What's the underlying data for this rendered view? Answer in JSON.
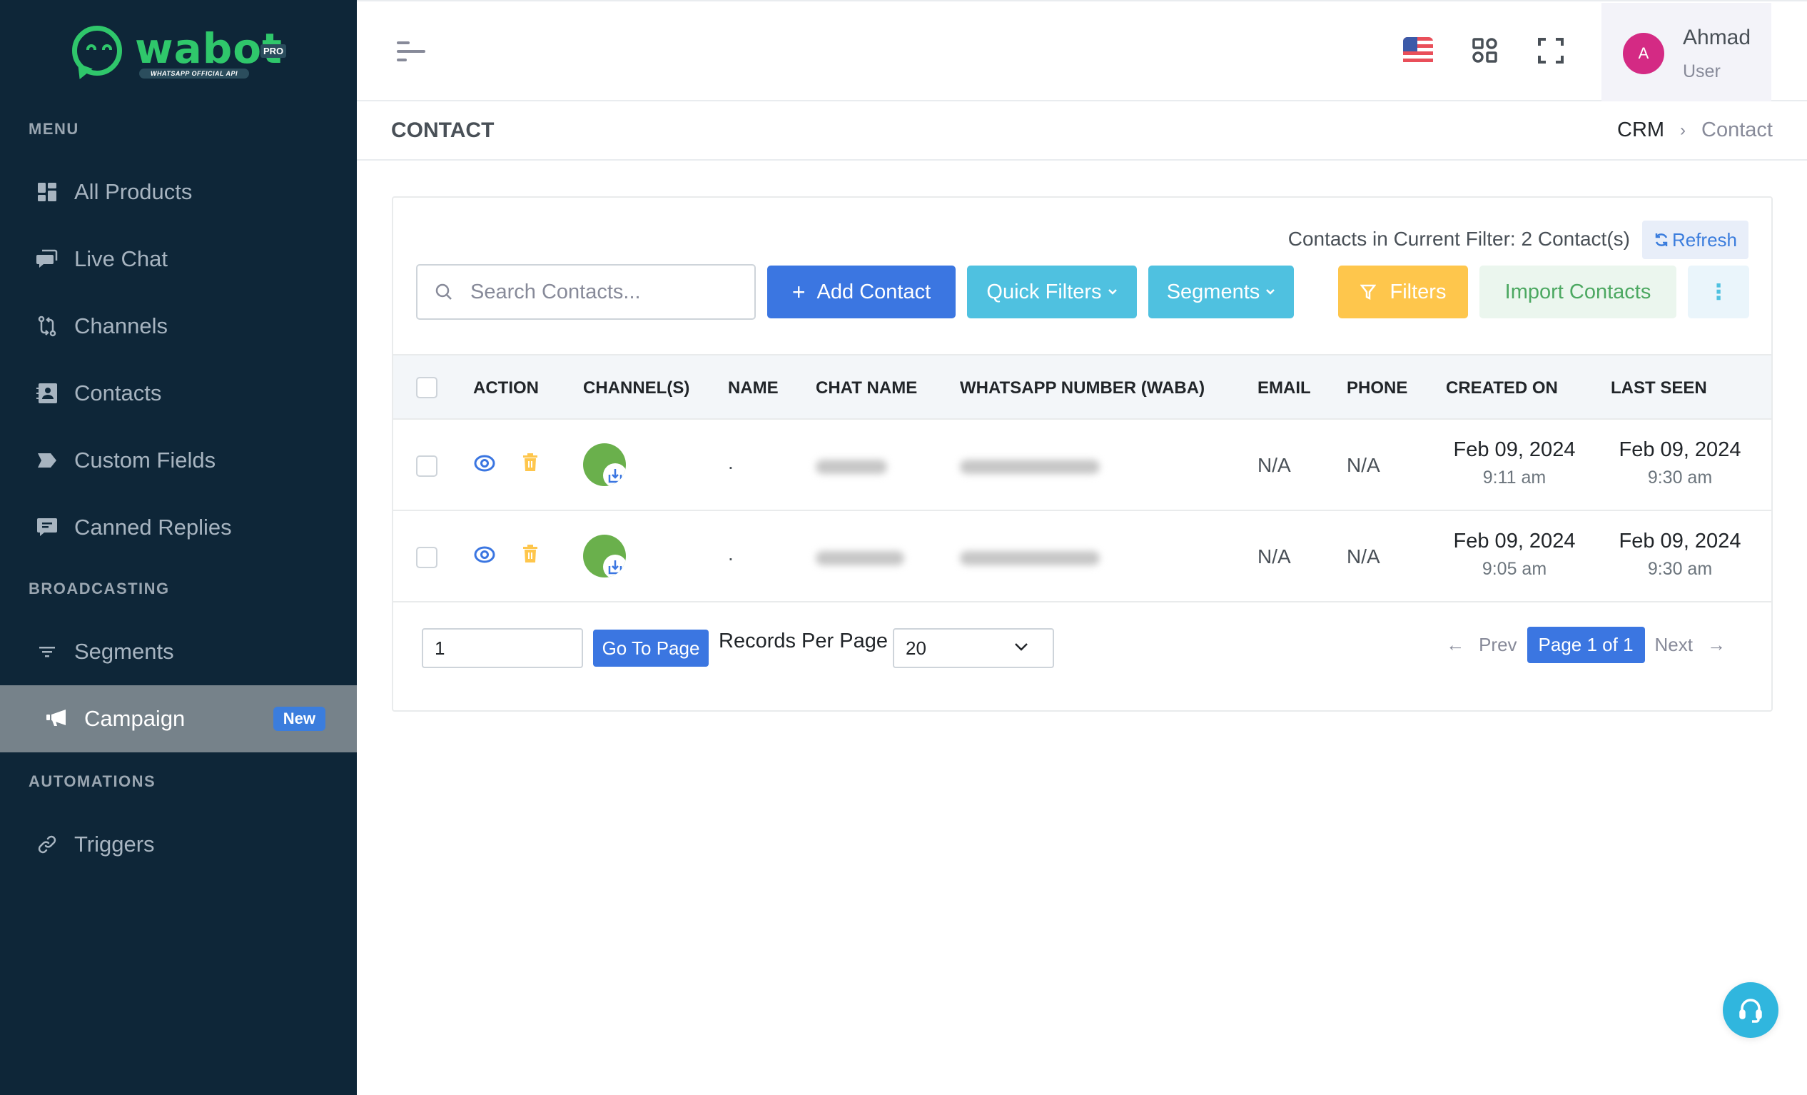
{
  "brand": {
    "name": "wabot",
    "badge": "PRO",
    "tagline": "WHATSAPP OFFICIAL API"
  },
  "sidebar": {
    "sections": [
      {
        "title": "MENU"
      },
      {
        "title": "BROADCASTING"
      },
      {
        "title": "AUTOMATIONS"
      }
    ],
    "items": [
      {
        "label": "All Products",
        "icon": "dashboard-icon"
      },
      {
        "label": "Live Chat",
        "icon": "chat-icon"
      },
      {
        "label": "Channels",
        "icon": "git-compare-icon"
      },
      {
        "label": "Contacts",
        "icon": "contact-book-icon"
      },
      {
        "label": "Custom Fields",
        "icon": "tag-icon"
      },
      {
        "label": "Canned Replies",
        "icon": "message-icon"
      },
      {
        "label": "Segments",
        "icon": "filter-icon"
      },
      {
        "label": "Campaign",
        "icon": "megaphone-icon",
        "badge": "New",
        "active": true
      },
      {
        "label": "Triggers",
        "icon": "link-icon"
      }
    ]
  },
  "header": {
    "user": {
      "initial": "A",
      "name": "Ahmad",
      "role": "User"
    },
    "language": "en-US"
  },
  "page": {
    "title": "CONTACT",
    "breadcrumb": [
      "CRM",
      "Contact"
    ]
  },
  "toolbar": {
    "filter_count": "Contacts in Current Filter: 2 Contact(s)",
    "refresh": "Refresh",
    "search_placeholder": "Search Contacts...",
    "search_value": "",
    "add_contact": "Add Contact",
    "quick_filters": "Quick Filters",
    "segments": "Segments",
    "filters": "Filters",
    "import_contacts": "Import Contacts",
    "more": "⋮"
  },
  "table": {
    "columns": [
      "ACTION",
      "CHANNEL(S)",
      "NAME",
      "CHAT NAME",
      "WHATSAPP NUMBER (WABA)",
      "EMAIL",
      "PHONE",
      "CREATED ON",
      "LAST SEEN"
    ],
    "rows": [
      {
        "name": ".",
        "chat_name": "[blurred]",
        "whatsapp_number": "[blurred]",
        "email": "N/A",
        "phone": "N/A",
        "created_date": "Feb 09, 2024",
        "created_time": "9:11 am",
        "last_seen_date": "Feb 09, 2024",
        "last_seen_time": "9:30 am"
      },
      {
        "name": ".",
        "chat_name": "[blurred]",
        "whatsapp_number": "[blurred]",
        "email": "N/A",
        "phone": "N/A",
        "created_date": "Feb 09, 2024",
        "created_time": "9:05 am",
        "last_seen_date": "Feb 09, 2024",
        "last_seen_time": "9:30 am"
      }
    ]
  },
  "pagination": {
    "page_input": "1",
    "go_to_page": "Go To Page",
    "records_per_page_label": "Records Per Page",
    "records_per_page": "20",
    "prev": "Prev",
    "next": "Next",
    "current": "Page 1 of 1",
    "prev_arrow": "←",
    "next_arrow": "→"
  },
  "colors": {
    "sidebar_bg": "#0e2638",
    "primary": "#3b76e1",
    "info": "#4fc1e0",
    "warning": "#fec64c",
    "success_soft": "#ebf6ee",
    "avatar": "#d42a84",
    "brand_green": "#2fc76b"
  }
}
